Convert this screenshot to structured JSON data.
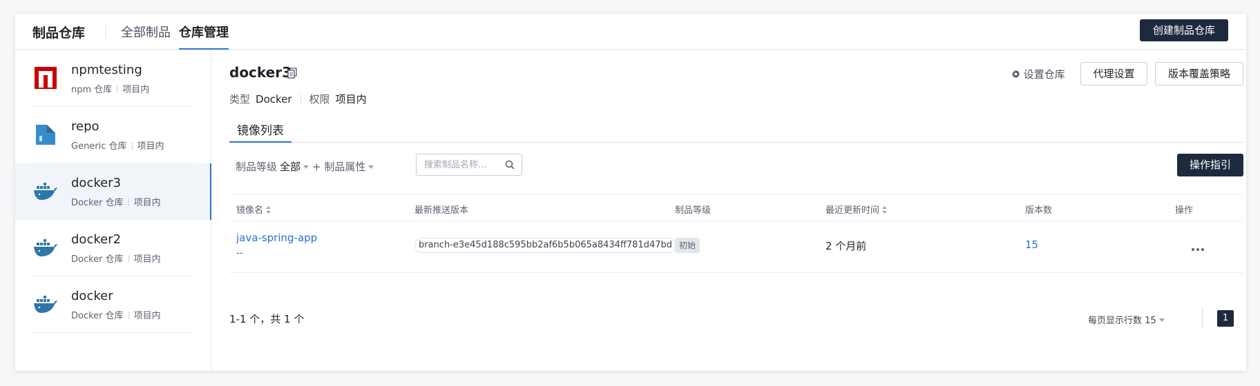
{
  "header": {
    "title": "制品仓库",
    "tabs": [
      {
        "label": "全部制品",
        "active": false
      },
      {
        "label": "仓库管理",
        "active": true
      }
    ],
    "create_button": "创建制品仓库"
  },
  "sidebar": {
    "repos": [
      {
        "name": "npmtesting",
        "type": "npm 仓库",
        "scope": "项目内",
        "icon": "npm-icon",
        "active": false
      },
      {
        "name": "repo",
        "type": "Generic 仓库",
        "scope": "项目内",
        "icon": "generic-repo-icon",
        "active": false
      },
      {
        "name": "docker3",
        "type": "Docker 仓库",
        "scope": "项目内",
        "icon": "docker-icon",
        "active": true
      },
      {
        "name": "docker2",
        "type": "Docker 仓库",
        "scope": "项目内",
        "icon": "docker-icon",
        "active": false
      },
      {
        "name": "docker",
        "type": "Docker 仓库",
        "scope": "项目内",
        "icon": "docker-icon",
        "active": false
      }
    ]
  },
  "detail": {
    "name": "docker3",
    "type_label": "类型",
    "type_value": "Docker",
    "perm_label": "权限",
    "perm_value": "项目内",
    "settings_label": "设置仓库",
    "proxy_button": "代理设置",
    "override_button": "版本覆盖策略",
    "subtab": "镜像列表"
  },
  "filters": {
    "level_label": "制品等级",
    "level_value": "全部",
    "attr_label": "+ 制品属性",
    "search_placeholder": "搜索制品名称...",
    "guide_button": "操作指引"
  },
  "table": {
    "columns": [
      "镜像名",
      "最新推送版本",
      "制品等级",
      "最近更新时间",
      "版本数",
      "操作"
    ],
    "rows": [
      {
        "name": "java-spring-app",
        "desc": "--",
        "latest_version": "branch-e3e45d188c595bb2af6b5b065a8434ff781d47bd",
        "level": "初始",
        "updated": "2 个月前",
        "versions": "15"
      }
    ]
  },
  "pagination": {
    "total_text": "1-1 个，共 1 个",
    "page_size_label": "每页显示行数",
    "page_size": "15",
    "current_page": "1"
  },
  "colors": {
    "accent": "#2b6fd6",
    "dark_button": "#1d2a3e",
    "npm_red": "#cb0000",
    "docker_blue": "#2f77a8"
  }
}
